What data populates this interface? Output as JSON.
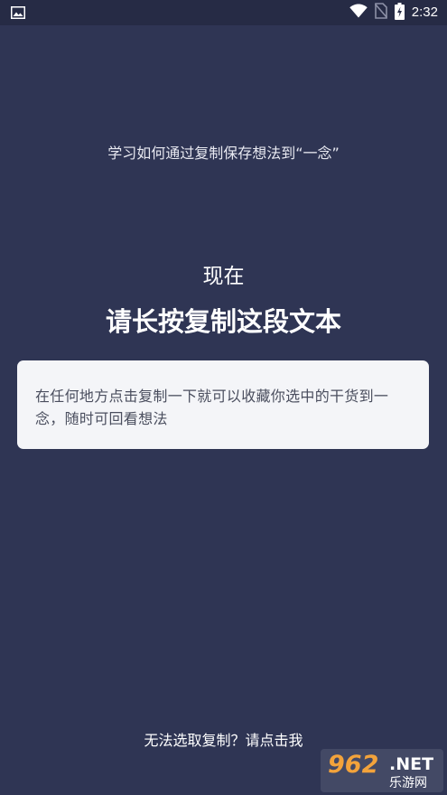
{
  "status_bar": {
    "time": "2:32",
    "icons": [
      "image-icon",
      "wifi-icon",
      "no-sim-icon",
      "battery-charging-icon"
    ]
  },
  "intro_text": "学习如何通过复制保存想法到“一念”",
  "now_label": "现在",
  "headline": "请长按复制这段文本",
  "card_text": "在任何地方点击复制一下就可以收藏你选中的干货到一念，随时可回看想法",
  "footer_link": "无法选取复制？请点击我",
  "watermark": {
    "number": "962",
    "net": ".NET",
    "cn": "乐游网"
  },
  "colors": {
    "background": "#2f3554",
    "card": "#f4f5f8",
    "watermark_accent": "#f3a33b"
  }
}
